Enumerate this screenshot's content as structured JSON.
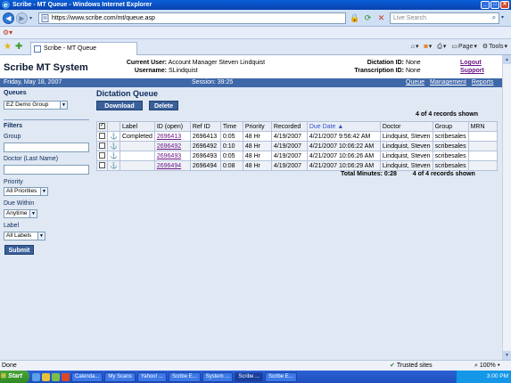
{
  "window": {
    "title": "Scribe - MT Queue - Windows Internet Explorer"
  },
  "browser": {
    "url": "https://www.scribe.com/mt/queue.asp",
    "search_placeholder": "Live Search",
    "tab_label": "Scribe - MT Queue",
    "commands": {
      "page": "Page",
      "tools": "Tools"
    },
    "status_done": "Done",
    "status_zone": "Trusted sites",
    "zoom": "100%"
  },
  "header": {
    "system_title": "Scribe MT System",
    "current_user_label": "Current User:",
    "current_user_value": "Account Manager Steven Lindquist",
    "username_label": "Username:",
    "username_value": "SLindquist",
    "dictation_id_label": "Dictation ID:",
    "dictation_id_value": "None",
    "transcription_id_label": "Transcription ID:",
    "transcription_id_value": "None",
    "logout": "Logout",
    "support": "Support"
  },
  "statusbar": {
    "date": "Friday, May 18, 2007",
    "session": "Session: 39:25",
    "links": [
      "Queue",
      "Management",
      "Reports"
    ]
  },
  "sidebar": {
    "queues_heading": "Queues",
    "queue_selected": "EZ Demo Group",
    "filters_heading": "Filters",
    "group_label": "Group",
    "doctor_label": "Doctor (Last Name)",
    "priority_label": "Priority",
    "priority_selected": "All Priorities",
    "due_within_label": "Due Within",
    "due_within_selected": "Anytime",
    "label_label": "Label",
    "label_selected": "All Labels",
    "submit": "Submit"
  },
  "queue": {
    "title": "Dictation Queue",
    "download": "Download",
    "delete": "Delete",
    "records_shown": "4 of 4 records shown",
    "total_minutes": "Total Minutes: 0:28",
    "columns": [
      "",
      "",
      "Label",
      "ID (open)",
      "Ref ID",
      "Time",
      "Priority",
      "Recorded",
      "Due Date ▲",
      "Doctor",
      "Group",
      "MRN"
    ],
    "rows": [
      {
        "label": "Completed",
        "id": "2696413",
        "ref_id": "2696413",
        "time": "0:05",
        "priority": "48 Hr",
        "recorded": "4/19/2007",
        "due": "4/21/2007 9:56:42 AM",
        "doctor": "Lindquist, Steven",
        "group": "scribesales",
        "mrn": ""
      },
      {
        "label": "",
        "id": "2696492",
        "ref_id": "2696492",
        "time": "0:10",
        "priority": "48 Hr",
        "recorded": "4/19/2007",
        "due": "4/21/2007 10:06:22 AM",
        "doctor": "Lindquist, Steven",
        "group": "scribesales",
        "mrn": ""
      },
      {
        "label": "",
        "id": "2696493",
        "ref_id": "2696493",
        "time": "0:05",
        "priority": "48 Hr",
        "recorded": "4/19/2007",
        "due": "4/21/2007 10:06:26 AM",
        "doctor": "Lindquist, Steven",
        "group": "scribesales",
        "mrn": ""
      },
      {
        "label": "",
        "id": "2696494",
        "ref_id": "2696494",
        "time": "0:08",
        "priority": "48 Hr",
        "recorded": "4/19/2007",
        "due": "4/21/2007 10:06:29 AM",
        "doctor": "Lindquist, Steven",
        "group": "scribesales",
        "mrn": ""
      }
    ]
  },
  "taskbar": {
    "start": "Start",
    "tasks": [
      "Calenda...",
      "My Scans",
      "Yahoo! ...",
      "Scribe E...",
      "System ...",
      "Scribe ...",
      "Scribe E..."
    ],
    "active_task_index": 5,
    "clock": "3:00 PM"
  }
}
